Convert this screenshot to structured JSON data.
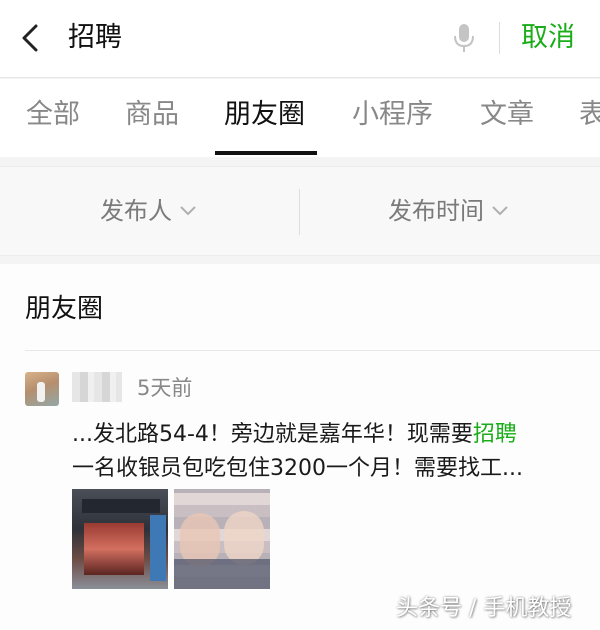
{
  "search": {
    "query": "招聘",
    "cancel_label": "取消"
  },
  "tabs": [
    {
      "label": "全部"
    },
    {
      "label": "商品"
    },
    {
      "label": "朋友圈"
    },
    {
      "label": "小程序"
    },
    {
      "label": "文章"
    },
    {
      "label": "表"
    }
  ],
  "active_tab": "朋友圈",
  "filters": {
    "publisher": "发布人",
    "publish_time": "发布时间"
  },
  "results": {
    "section_title": "朋友圈",
    "post": {
      "time": "5天前",
      "text_line1_prefix": "...发北路54-4！旁边就是嘉年华！现需要",
      "text_line1_highlight": "招聘",
      "text_line2": "一名收银员包吃包住3200一个月！需要找工..."
    }
  },
  "watermark": "头条号 / 手机教授",
  "colors": {
    "accent": "#1aad19",
    "text": "#111111",
    "muted": "#888888"
  }
}
